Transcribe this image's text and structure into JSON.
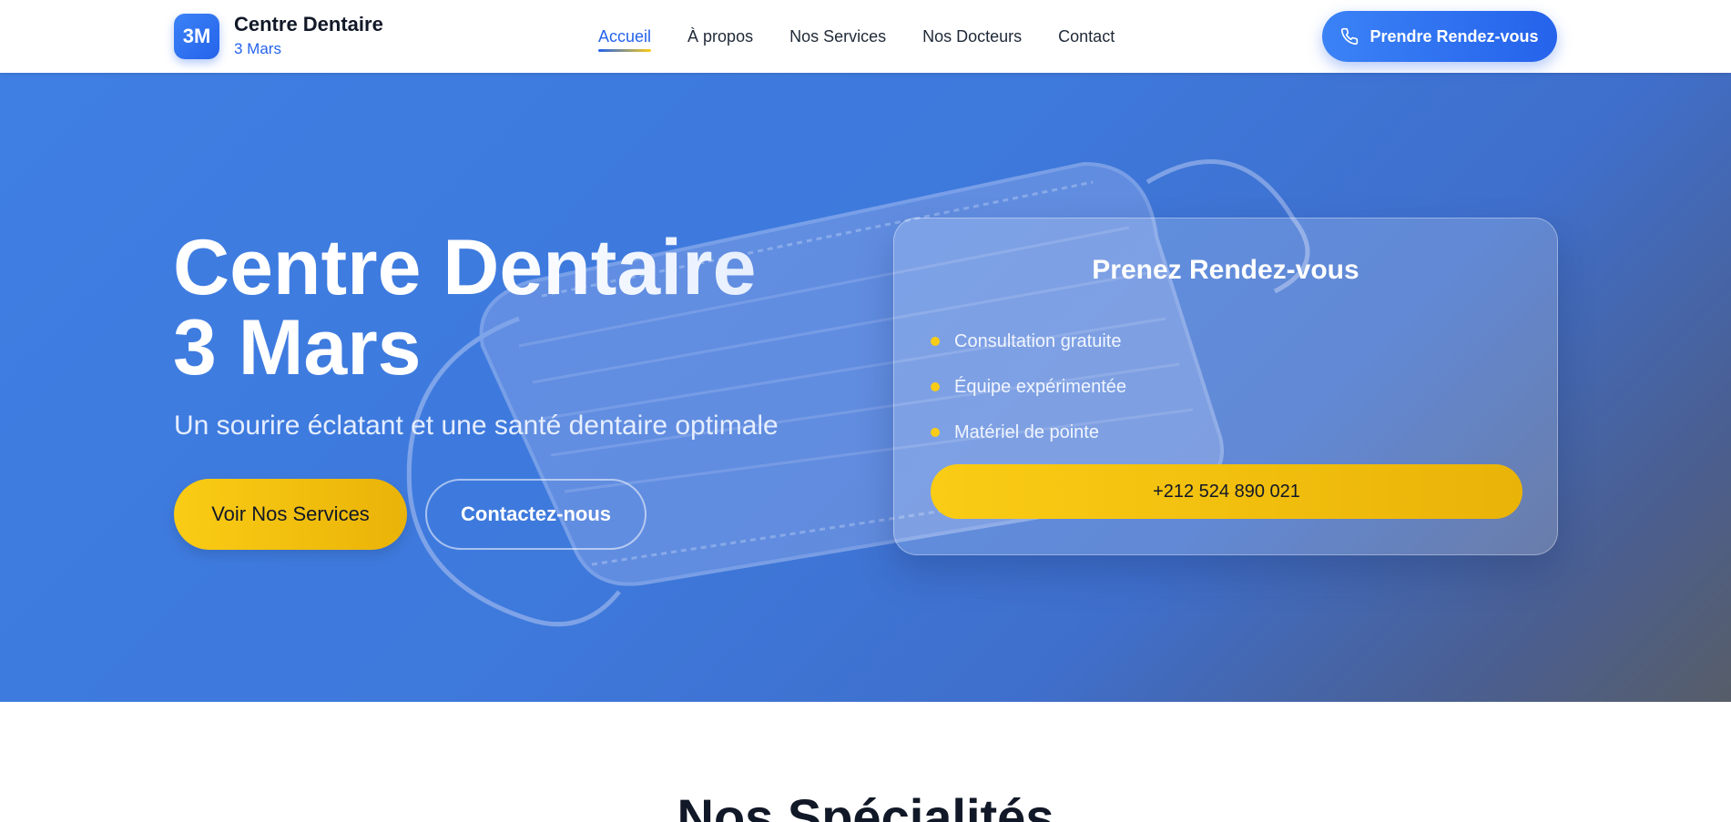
{
  "header": {
    "logo_badge": "3M",
    "logo_title": "Centre Dentaire",
    "logo_subtitle": "3 Mars",
    "nav": [
      {
        "label": "Accueil",
        "active": true
      },
      {
        "label": "À propos",
        "active": false
      },
      {
        "label": "Nos Services",
        "active": false
      },
      {
        "label": "Nos Docteurs",
        "active": false
      },
      {
        "label": "Contact",
        "active": false
      }
    ],
    "cta_label": "Prendre Rendez-vous",
    "cta_icon": "phone-icon"
  },
  "hero": {
    "title_line1": "Centre Dentaire",
    "title_line2": "3 Mars",
    "subtitle": "Un sourire éclatant et une santé dentaire optimale",
    "primary_button": "Voir Nos Services",
    "secondary_button": "Contactez-nous",
    "background_image": "surgical-mask-photo"
  },
  "appointment_card": {
    "title": "Prenez Rendez-vous",
    "features": [
      "Consultation gratuite",
      "Équipe expérimentée",
      "Matériel de pointe"
    ],
    "phone": "+212 524 890 021"
  },
  "next_section": {
    "title": "Nos Spécialités"
  },
  "colors": {
    "primary_blue": "#2563eb",
    "accent_yellow": "#facc15",
    "hero_blue": "#3f7ee3",
    "text_dark": "#111827"
  }
}
